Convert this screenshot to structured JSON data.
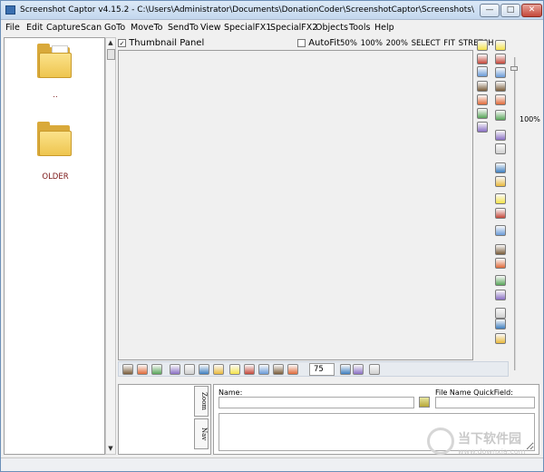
{
  "window": {
    "title": "Screenshot Captor v4.15.2 - C:\\Users\\Administrator\\Documents\\DonationCoder\\ScreenshotCaptor\\Screenshots\\",
    "min_glyph": "—",
    "max_glyph": "□",
    "close_glyph": "✕"
  },
  "menu": [
    "File",
    "Edit",
    "Capture",
    "Scan",
    "GoTo",
    "MoveTo",
    "SendTo",
    "View",
    "SpecialFX1",
    "SpecialFX2",
    "Objects",
    "Tools",
    "Help"
  ],
  "folders": [
    {
      "label": ".."
    },
    {
      "label": "OLDER"
    }
  ],
  "viewer": {
    "thumbnail_panel_label": "Thumbnail Panel",
    "thumbnail_checked": "✓",
    "autofit_label": "AutoFit",
    "zoom_links": "50% 100% 200% SELECT FIT STRETCH"
  },
  "zoom": {
    "percent_label": "100%",
    "level": 0.03
  },
  "bottom_toolbar": {
    "zoom_value": "75"
  },
  "lower_tabs": [
    "Zoom",
    "Nav"
  ],
  "fields": {
    "name_label": "Name:",
    "name_value": "",
    "quickfield_label": "File Name QuickField:",
    "quickfield_value": ""
  },
  "watermark": {
    "title": "当下软件园",
    "url": "www.downxia.com"
  },
  "icons": {
    "tools_col1": [
      "yellow-note-icon",
      "pen-icon",
      "text-box-icon",
      "brush-icon",
      "color-dots-icon",
      "stamp-icon",
      "image-icon"
    ],
    "tools_col2": [
      "save-icon",
      "floppy-red-icon",
      "edit-icon",
      "letter-t-icon",
      "crop-special-icon",
      "color-pick-icon",
      "bucket-icon",
      "red-blob-icon",
      "screen-capture-icon",
      "link-icon",
      "select-rect-icon",
      "resize-icon",
      "crop-icon",
      "frame-icon",
      "shadow-icon",
      "box-icon",
      "border-icon",
      "highlighter-icon",
      "arrow-pointer-icon",
      "move-icon"
    ],
    "bottom": [
      "rotate-left-icon",
      "rotate-right-icon",
      "flip-icon",
      "mountain-icon",
      "blue-circle-icon",
      "globe-icon",
      "green-square-icon",
      "triangle-icon",
      "grid-a-icon",
      "grid-b-icon",
      "grid-c-icon",
      "grid-d-icon",
      "color-wheel-icon",
      "zoom-stepper-icon",
      "image-small-icon",
      "cursor-icon",
      "doc-icon"
    ]
  }
}
